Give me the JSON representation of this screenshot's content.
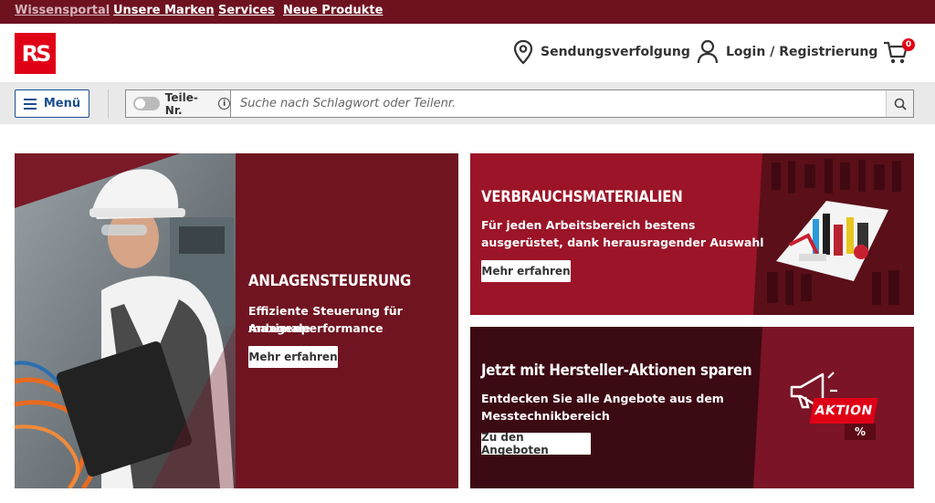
{
  "topnav": {
    "items": [
      "Wissensportal",
      "Unsere Marken",
      "Services",
      "Neue Produkte"
    ]
  },
  "header": {
    "logo_text": "RS",
    "tracking_label": "Sendungsverfolgung",
    "login_label": "Login / Registrierung",
    "cart_count": "0"
  },
  "searchbar": {
    "menu_label": "Menü",
    "toggle_label": "Teile-Nr.",
    "info_glyph": "i",
    "placeholder": "Suche nach Schlagwort oder Teilenr."
  },
  "banners": [
    {
      "title": "ANLAGENSTEUERUNG",
      "text_line1": "Effiziente Steuerung für maximale",
      "text_line2": "Anlagenperformance",
      "cta": "Mehr erfahren"
    },
    {
      "title": "VERBRAUCHSMATERIALIEN",
      "text_line1": "Für jeden Arbeitsbereich bestens",
      "text_line2": "ausgerüstet, dank herausragender Auswahl",
      "cta": "Mehr erfahren"
    },
    {
      "title": "Jetzt mit Hersteller-Aktionen sparen",
      "text_line1": "Entdecken Sie alle Angebote aus dem",
      "text_line2": "Messtechnikbereich",
      "cta": "Zu den Angeboten",
      "badge_text": "AKTION",
      "badge_percent": "%"
    }
  ],
  "colors": {
    "topbar": "#6e1220",
    "brand_red": "#e00016",
    "menu_blue": "#1a4f8f",
    "banner_dark_red": "#701421",
    "banner_red": "#9b1428",
    "banner_dark": "#3c0a13"
  }
}
